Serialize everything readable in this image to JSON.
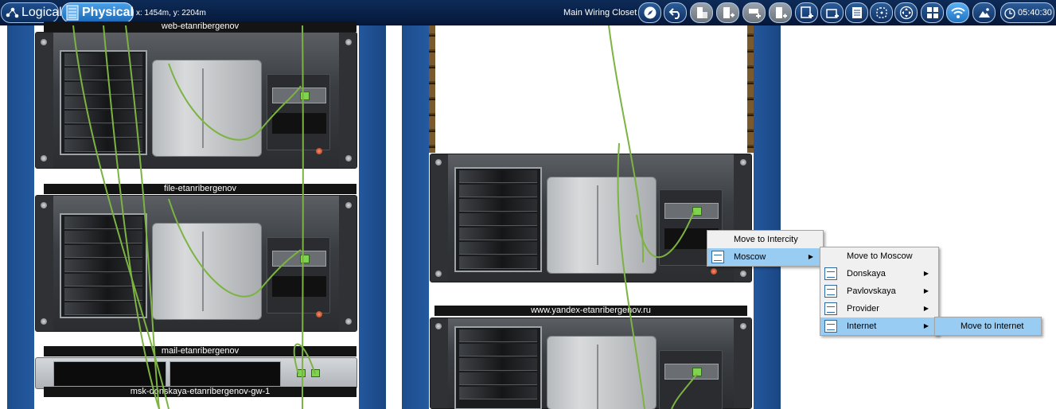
{
  "toolbar": {
    "logical_label": "Logical",
    "physical_label": "Physical",
    "coords": "x: 1454m, y: 2204m",
    "location": "Main Wiring Closet",
    "clock": "05:40:30",
    "icons": [
      "navigate-icon",
      "back-icon",
      "move-object-icon",
      "new-rack-icon",
      "new-shelf-icon",
      "new-device-icon",
      "new-closet-icon",
      "new-building-icon",
      "inventory-icon",
      "workspace-icon",
      "pan-icon",
      "grid-icon",
      "wireless-icon",
      "background-image-icon",
      "clock-icon"
    ]
  },
  "rack_left": {
    "devices": [
      {
        "label": "web-etanribergenov"
      },
      {
        "label": "file-etanribergenov"
      },
      {
        "label": "mail-etanribergenov"
      },
      {
        "label": "msk-donskaya-etanribergenov-gw-1"
      }
    ]
  },
  "rack_right": {
    "devices": [
      {
        "label": "www.yandex-etanribergenov.ru"
      }
    ]
  },
  "context_menu": {
    "level1": [
      {
        "label": "Move to Intercity",
        "icon": ""
      },
      {
        "label": "Moscow",
        "icon": "city-icon",
        "submenu": true
      }
    ],
    "level2": [
      {
        "label": "Move to Moscow",
        "icon": ""
      },
      {
        "label": "Donskaya",
        "icon": "building-icon",
        "submenu": true
      },
      {
        "label": "Pavlovskaya",
        "icon": "building-icon",
        "submenu": true
      },
      {
        "label": "Provider",
        "icon": "building-icon",
        "submenu": true
      },
      {
        "label": "Internet",
        "icon": "building-icon",
        "submenu": true
      }
    ],
    "level3": [
      {
        "label": "Move to Internet",
        "icon": ""
      }
    ]
  },
  "colors": {
    "toolbar_bg": "#0d2b57",
    "rack_blue": "#2a63ae",
    "cable_green": "#7cb342",
    "menu_highlight": "#99ccf3"
  }
}
